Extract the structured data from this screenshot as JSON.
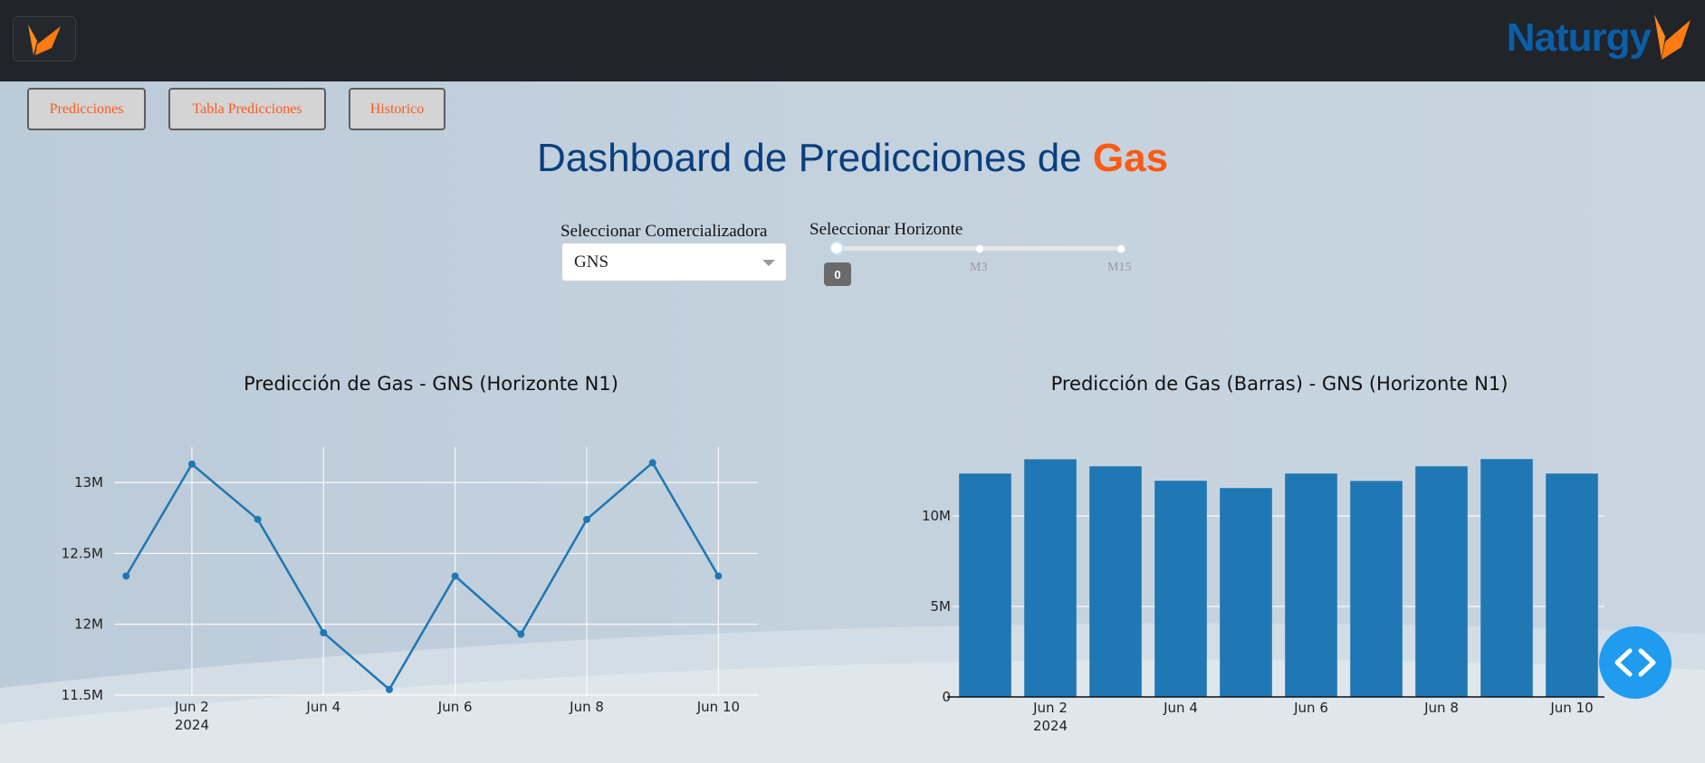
{
  "header": {
    "brand": "Naturgy"
  },
  "nav": [
    {
      "label": "Predicciones"
    },
    {
      "label": "Tabla Predicciones"
    },
    {
      "label": "Historico"
    }
  ],
  "title": {
    "prefix": "Dashboard de Predicciones de",
    "highlight": "Gas"
  },
  "controls": {
    "comercializadora_label": "Seleccionar Comercializadora",
    "comercializadora_value": "GNS",
    "horizonte_label": "Seleccionar Horizonte",
    "horizonte_marks": [
      "M3",
      "M15"
    ],
    "horizonte_value": "0"
  },
  "colors": {
    "series": "#1f77b4",
    "accent": "#ff5a12",
    "title": "#0a3f7e",
    "brand": "#0b5ea8"
  },
  "chart_data": [
    {
      "type": "line",
      "title": "Predicción de Gas - GNS (Horizonte N1)",
      "x": [
        "2024-06-01",
        "2024-06-02",
        "2024-06-03",
        "2024-06-04",
        "2024-06-05",
        "2024-06-06",
        "2024-06-07",
        "2024-06-08",
        "2024-06-09",
        "2024-06-10"
      ],
      "values": [
        12340000,
        13130000,
        12740000,
        11940000,
        11540000,
        12340000,
        11930000,
        12740000,
        13140000,
        12340000
      ],
      "xticks": [
        "Jun 2\n2024",
        "Jun 4",
        "Jun 6",
        "Jun 8",
        "Jun 10"
      ],
      "yticks": [
        "11.5M",
        "12M",
        "12.5M",
        "13M"
      ],
      "ylim": [
        11500000,
        13250000
      ],
      "grid": true
    },
    {
      "type": "bar",
      "title": "Predicción de Gas (Barras) - GNS (Horizonte N1)",
      "x": [
        "2024-06-01",
        "2024-06-02",
        "2024-06-03",
        "2024-06-04",
        "2024-06-05",
        "2024-06-06",
        "2024-06-07",
        "2024-06-08",
        "2024-06-09",
        "2024-06-10"
      ],
      "values": [
        12340000,
        13130000,
        12740000,
        11940000,
        11540000,
        12340000,
        11930000,
        12740000,
        13140000,
        12340000
      ],
      "xticks": [
        "Jun 2\n2024",
        "Jun 4",
        "Jun 6",
        "Jun 8",
        "Jun 10"
      ],
      "yticks": [
        "0",
        "5M",
        "10M"
      ],
      "ylim": [
        0,
        13800000
      ],
      "grid": true
    }
  ]
}
